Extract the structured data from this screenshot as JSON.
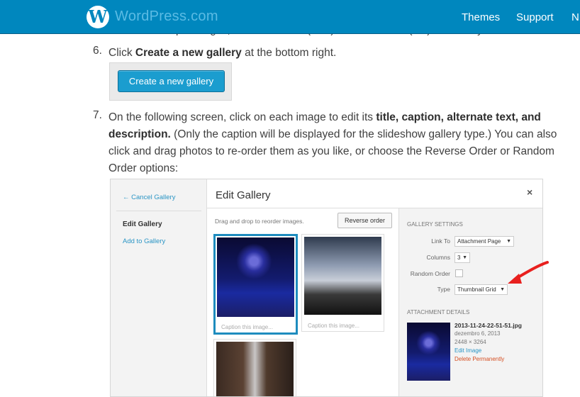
{
  "header": {
    "brand": "WordPress.com",
    "logo_letter": "W",
    "nav": [
      "Themes",
      "Support",
      "N"
    ],
    "colors": {
      "bar": "#0087be",
      "brand_text": "#5bbbe4"
    }
  },
  "article": {
    "partial_line": "To select multiple images, command-click (Mac) or control-click (PC) the ones you want to use.",
    "step6": {
      "number": "6.",
      "prefix": "Click ",
      "bold": "Create a new gallery",
      "suffix": " at the bottom right.",
      "button_label": "Create a new gallery"
    },
    "step7": {
      "number": "7.",
      "text1": "On the following screen, click on each image to edit its ",
      "bold1": "title, caption, alternate text, and description.",
      "text2": " (Only the caption will be displayed for the slideshow gallery type.) You can also click and drag photos to re-order them as you like, or choose the Reverse Order or Random Order options:"
    }
  },
  "screenshot": {
    "sidebar": {
      "cancel": "← Cancel Gallery",
      "edit": "Edit Gallery",
      "add": "Add to Gallery"
    },
    "title": "Edit Gallery",
    "close": "×",
    "drag_hint": "Drag and drop to reorder images.",
    "reverse_button": "Reverse order",
    "caption_placeholder": "Caption this image...",
    "settings": {
      "title": "Gallery Settings",
      "link_to_label": "Link To",
      "link_to_value": "Attachment Page",
      "columns_label": "Columns",
      "columns_value": "3",
      "random_label": "Random Order",
      "type_label": "Type",
      "type_value": "Thumbnail Grid"
    },
    "attachment": {
      "title": "Attachment Details",
      "filename": "2013-11-24-22-51-51.jpg",
      "date": "dezembro 6, 2013",
      "dimensions": "2448 × 3264",
      "edit": "Edit Image",
      "delete": "Delete Permanently"
    },
    "arrow_color": "#e8201e"
  }
}
